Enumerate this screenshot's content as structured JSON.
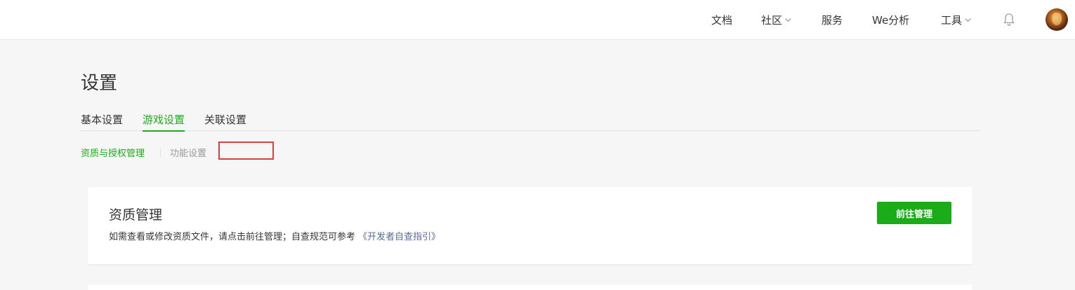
{
  "nav": {
    "items": [
      {
        "label": "文档",
        "has_dropdown": false
      },
      {
        "label": "社区",
        "has_dropdown": true
      },
      {
        "label": "服务",
        "has_dropdown": false
      },
      {
        "label": "We分析",
        "has_dropdown": false
      },
      {
        "label": "工具",
        "has_dropdown": true
      }
    ],
    "notification_icon": "bell-icon",
    "avatar_icon": "user-avatar"
  },
  "page": {
    "title": "设置"
  },
  "tabs": [
    {
      "label": "基本设置",
      "active": false
    },
    {
      "label": "游戏设置",
      "active": true
    },
    {
      "label": "关联设置",
      "active": false
    }
  ],
  "subtabs": [
    {
      "label": "资质与授权管理",
      "active": true
    },
    {
      "label": "功能设置",
      "active": false
    }
  ],
  "card": {
    "title": "资质管理",
    "description": "如需查看或修改资质文件，请点击前往管理；自查规范可参考",
    "link_text": "《开发者自查指引》",
    "button_label": "前往管理"
  },
  "colors": {
    "accent": "#1aad19",
    "link": "#576b95",
    "highlight_border": "#d9413f"
  }
}
